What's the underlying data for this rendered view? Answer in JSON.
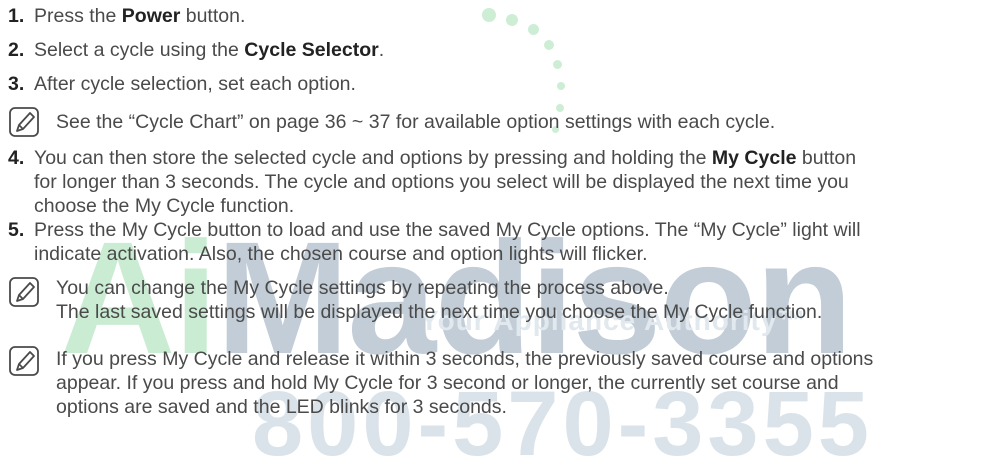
{
  "steps_a": [
    {
      "number": "1.",
      "before": "Press the ",
      "bold": "Power",
      "after": " button."
    },
    {
      "number": "2.",
      "before": "Select a cycle using the ",
      "bold": "Cycle Selector",
      "after": "."
    },
    {
      "number": "3.",
      "text": "After cycle selection, set each option."
    }
  ],
  "note_1": "See the “Cycle Chart” on page 36 ~ 37 for available option settings with each cycle.",
  "steps_b": [
    {
      "number": "4.",
      "line1_before": "You can then store the selected cycle and options by pressing and holding the ",
      "line1_bold": "My Cycle",
      "line1_after": " button",
      "line2": "for longer than 3 seconds. The cycle and options you select will be displayed the next time you",
      "line3": "choose the My Cycle function."
    },
    {
      "number": "5.",
      "line1": "Press the My Cycle button to load and use the saved My Cycle options. The “My Cycle” light will",
      "line2": "indicate activation. Also, the chosen course and option lights will flicker."
    }
  ],
  "note_2": {
    "line1": "You can change the My Cycle settings by repeating the process above.",
    "line2": "The last saved settings will be displayed the next time you choose the My Cycle function."
  },
  "note_3": {
    "line1": "If you press My Cycle and release it within 3 seconds, the previously saved course and options",
    "line2": "appear. If you press and hold My Cycle for 3 second or longer, the currently set course and",
    "line3": "options are saved and the LED blinks for 3 seconds."
  },
  "watermark": {
    "brand_a": "Ai",
    "brand_b": "Madison",
    "sub": "Your Appliance Authority™",
    "phone": "800-570-3355"
  },
  "icons": {
    "note": "note-pencil-icon"
  }
}
